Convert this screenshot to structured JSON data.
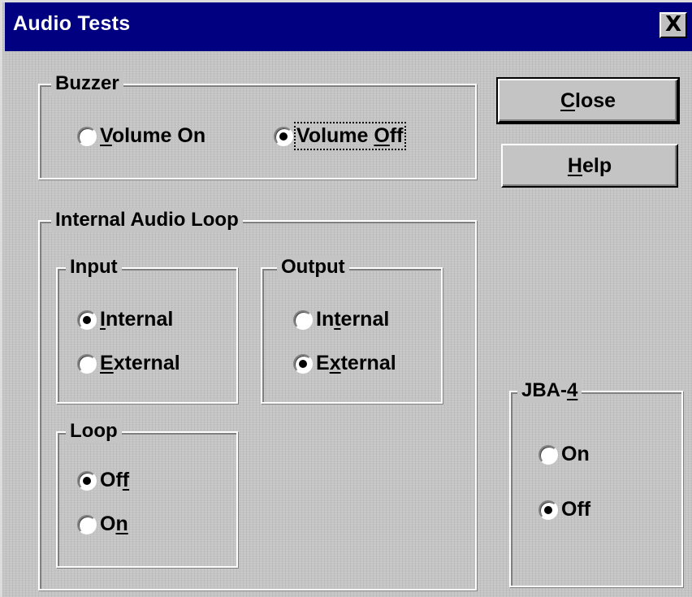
{
  "window": {
    "title": "Audio Tests",
    "close_glyph": "X"
  },
  "buttons": {
    "close": {
      "pre": "",
      "key": "C",
      "post": "lose"
    },
    "help": {
      "pre": "",
      "key": "H",
      "post": "elp"
    }
  },
  "buzzer": {
    "legend": "Buzzer",
    "volume_on": {
      "pre": "",
      "key": "V",
      "post": "olume On",
      "checked": false
    },
    "volume_off": {
      "pre": "Volume ",
      "key": "O",
      "post": "ff",
      "checked": true
    }
  },
  "internal_audio_loop": {
    "legend": "Internal Audio Loop",
    "input": {
      "legend": "Input",
      "internal": {
        "pre": "",
        "key": "I",
        "post": "nternal",
        "checked": true
      },
      "external": {
        "pre": "",
        "key": "E",
        "post": "xternal",
        "checked": false
      }
    },
    "output": {
      "legend": "Output",
      "internal": {
        "pre": "In",
        "key": "t",
        "post": "ernal",
        "checked": false
      },
      "external": {
        "pre": "E",
        "key": "x",
        "post": "ternal",
        "checked": true
      }
    },
    "loop": {
      "legend": "Loop",
      "off": {
        "pre": "Of",
        "key": "f",
        "post": "",
        "checked": true
      },
      "on": {
        "pre": "O",
        "key": "n",
        "post": "",
        "checked": false
      }
    }
  },
  "jba4": {
    "legend_pre": "JBA-",
    "legend_key": "4",
    "on": {
      "label": "On",
      "checked": false
    },
    "off": {
      "label": "Off",
      "checked": true
    }
  }
}
